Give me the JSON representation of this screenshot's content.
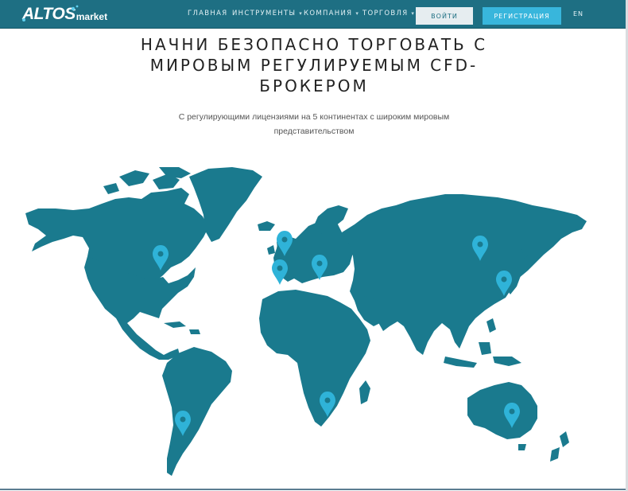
{
  "header": {
    "logo": {
      "primary": "ALTOS",
      "secondary": "market"
    },
    "nav": [
      {
        "label": "ГЛАВНАЯ",
        "dropdown": false
      },
      {
        "label": "ИНСТРУМЕНТЫ",
        "dropdown": true
      },
      {
        "label": "КОМПАНИЯ",
        "dropdown": true
      },
      {
        "label": "ТОРГОВЛЯ",
        "dropdown": true
      }
    ],
    "login_label": "ВОЙТИ",
    "register_label": "РЕГИСТРАЦИЯ",
    "language": "EN"
  },
  "hero": {
    "title_lines": [
      "НАЧНИ БЕЗОПАСНО ТОРГОВАТЬ С",
      "МИРОВЫМ РЕГУЛИРУЕМЫМ CFD-",
      "БРОКЕРОМ"
    ],
    "subtitle_lines": [
      "С регулирующими лицензиями на 5 континентах с широким мировым",
      "представительством"
    ]
  },
  "map": {
    "land_color": "#1a7a8e",
    "pin_color": "#2fb3d8",
    "pins": 9
  },
  "colors": {
    "nav_bg": "#1e6f83",
    "accent": "#38b6dc"
  }
}
